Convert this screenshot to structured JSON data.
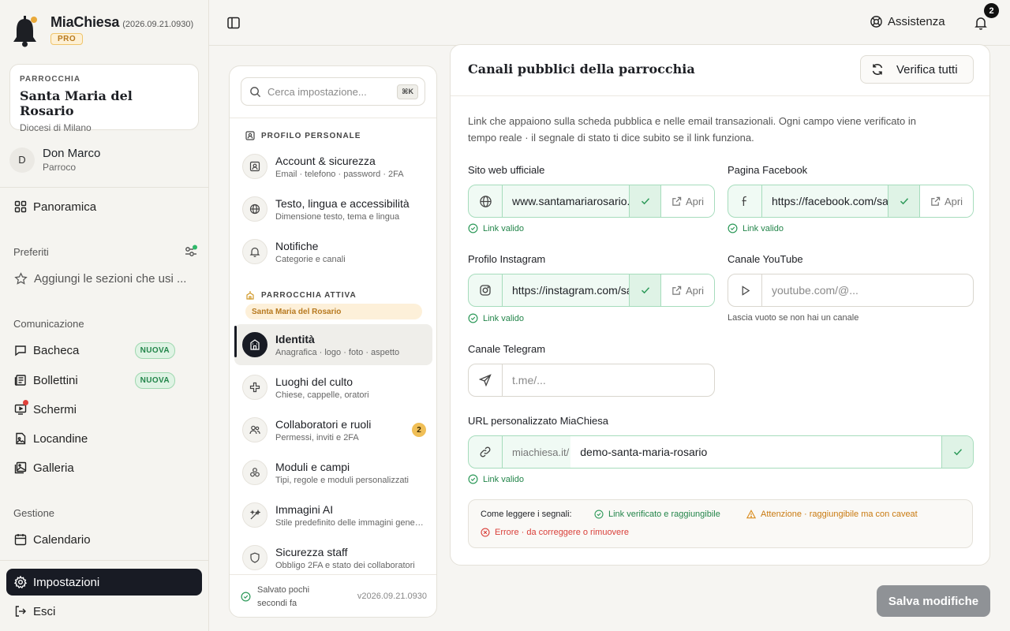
{
  "brand": {
    "name": "MiaChiesa",
    "version": "(2026.09.21.0930)",
    "plan": "PRO"
  },
  "parish": {
    "label": "PARROCCHIA",
    "name": "Santa Maria del Rosario",
    "diocese": "Diocesi di Milano"
  },
  "user": {
    "initial": "D",
    "name": "Don Marco",
    "role": "Parroco"
  },
  "nav": {
    "overview": "Panoramica",
    "favorites_title": "Preferiti",
    "favorites_add": "Aggiungi le sezioni che usi ...",
    "communication_title": "Comunicazione",
    "communication": [
      {
        "label": "Bacheca",
        "badge": "NUOVA"
      },
      {
        "label": "Bollettini",
        "badge": "NUOVA"
      },
      {
        "label": "Schermi"
      },
      {
        "label": "Locandine"
      },
      {
        "label": "Galleria"
      }
    ],
    "management_title": "Gestione",
    "calendar": "Calendario",
    "settings": "Impostazioni",
    "logout": "Esci"
  },
  "topbar": {
    "help": "Assistenza",
    "notifications": "2"
  },
  "settings_nav": {
    "search_placeholder": "Cerca impostazione...",
    "shortcut": "⌘K",
    "personal_title": "PROFILO PERSONALE",
    "personal": [
      {
        "title": "Account & sicurezza",
        "subtitle": "Email · telefono · password · 2FA"
      },
      {
        "title": "Testo, lingua e accessibilità",
        "subtitle": "Dimensione testo, tema e lingua"
      },
      {
        "title": "Notifiche",
        "subtitle": "Categorie e canali"
      }
    ],
    "parish_title": "PARROCCHIA ATTIVA",
    "active_parish": "Santa Maria del Rosario",
    "parish_items": [
      {
        "title": "Identità",
        "subtitle": "Anagrafica · logo · foto · aspetto"
      },
      {
        "title": "Luoghi del culto",
        "subtitle": "Chiese, cappelle, oratori"
      },
      {
        "title": "Collaboratori e ruoli",
        "subtitle": "Permessi, inviti e 2FA",
        "count": "2"
      },
      {
        "title": "Moduli e campi",
        "subtitle": "Tipi, regole e moduli personalizzati"
      },
      {
        "title": "Immagini AI",
        "subtitle": "Stile predefinito delle immagini generate"
      },
      {
        "title": "Sicurezza staff",
        "subtitle": "Obbligo 2FA e stato dei collaboratori"
      }
    ],
    "saved": "Salvato pochi secondi fa",
    "version": "v2026.09.21.0930"
  },
  "card": {
    "title": "Canali pubblici della parrocchia",
    "verify_all": "Verifica tutti",
    "description": "Link che appaiono sulla scheda pubblica e nelle email transazionali. Ogni campo viene verificato in tempo reale · il segnale di stato ti dice subito se il link funziona.",
    "open_label": "Apri",
    "valid_label": "Link valido",
    "fields": {
      "website": {
        "label": "Sito web ufficiale",
        "value": "www.santamariarosario.it"
      },
      "facebook": {
        "label": "Pagina Facebook",
        "value": "https://facebook.com/santamariarosario"
      },
      "instagram": {
        "label": "Profilo Instagram",
        "value": "https://instagram.com/santamariarosario"
      },
      "youtube": {
        "label": "Canale YouTube",
        "placeholder": "youtube.com/@...",
        "hint": "Lascia vuoto se non hai un canale"
      },
      "telegram": {
        "label": "Canale Telegram",
        "placeholder": "t.me/..."
      },
      "custom_url": {
        "label": "URL personalizzato MiaChiesa",
        "prefix": "miachiesa.it/",
        "value": "demo-santa-maria-rosario"
      }
    },
    "legend": {
      "title": "Come leggere i segnali:",
      "ok": "Link verificato e raggiungibile",
      "warn": "Attenzione · raggiungibile ma con caveat",
      "error": "Errore · da correggere o rimuovere"
    }
  },
  "save_label": "Salva modifiche",
  "colors": {
    "accent": "#181b24",
    "success": "#23854a",
    "warning": "#d98b1b",
    "error": "#d9403a",
    "pro": "#b7791f"
  }
}
